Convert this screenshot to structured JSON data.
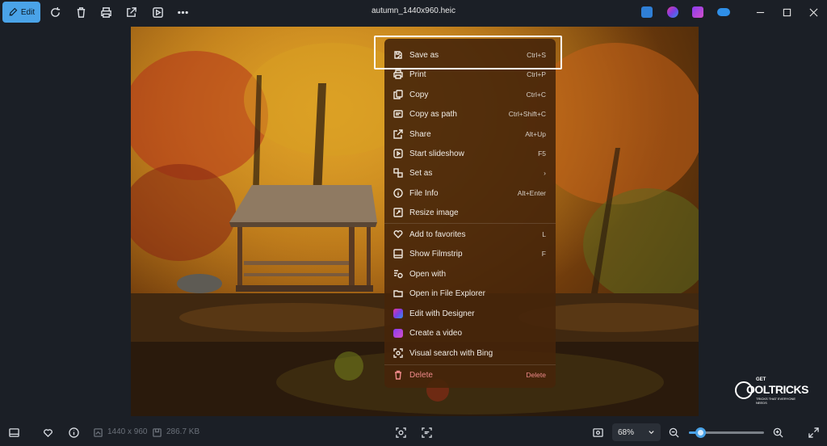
{
  "toolbar": {
    "edit_label": "Edit",
    "filename": "autumn_1440x960.heic"
  },
  "menu": {
    "items": [
      {
        "label": "Save as",
        "shortcut": "Ctrl+S",
        "icon": "save-as-icon"
      },
      {
        "label": "Print",
        "shortcut": "Ctrl+P",
        "icon": "print-icon"
      },
      {
        "label": "Copy",
        "shortcut": "Ctrl+C",
        "icon": "copy-icon"
      },
      {
        "label": "Copy as path",
        "shortcut": "Ctrl+Shift+C",
        "icon": "copy-path-icon"
      },
      {
        "label": "Share",
        "shortcut": "Alt+Up",
        "icon": "share-icon"
      },
      {
        "label": "Start slideshow",
        "shortcut": "F5",
        "icon": "slideshow-icon"
      },
      {
        "label": "Set as",
        "shortcut": "›",
        "icon": "set-as-icon"
      },
      {
        "label": "File Info",
        "shortcut": "Alt+Enter",
        "icon": "info-icon"
      },
      {
        "label": "Resize image",
        "shortcut": "",
        "icon": "resize-icon"
      },
      {
        "label": "Add to favorites",
        "shortcut": "L",
        "icon": "heart-icon"
      },
      {
        "label": "Show Filmstrip",
        "shortcut": "F",
        "icon": "filmstrip-icon"
      },
      {
        "label": "Open with",
        "shortcut": "",
        "icon": "open-with-icon"
      },
      {
        "label": "Open in File Explorer",
        "shortcut": "",
        "icon": "folder-icon"
      },
      {
        "label": "Edit with Designer",
        "shortcut": "",
        "icon": "designer-icon"
      },
      {
        "label": "Create a video",
        "shortcut": "",
        "icon": "clipchamp-icon"
      },
      {
        "label": "Visual search with Bing",
        "shortcut": "",
        "icon": "visual-search-icon"
      },
      {
        "label": "Delete",
        "shortcut": "Delete",
        "icon": "trash-icon"
      }
    ]
  },
  "status": {
    "dimensions": "1440 x 960",
    "filesize": "286.7 KB",
    "zoom": "68%",
    "zoom_fraction": 0.15
  },
  "watermark": {
    "small": "GET",
    "main": "OOLTRICKS",
    "tagline": "TRICKS THAT EVERYONE NEEDS"
  },
  "colors": {
    "accent": "#4aa3e8",
    "background": "#1b1f26",
    "menu_bg": "#46250a",
    "danger": "#f08a8a"
  }
}
